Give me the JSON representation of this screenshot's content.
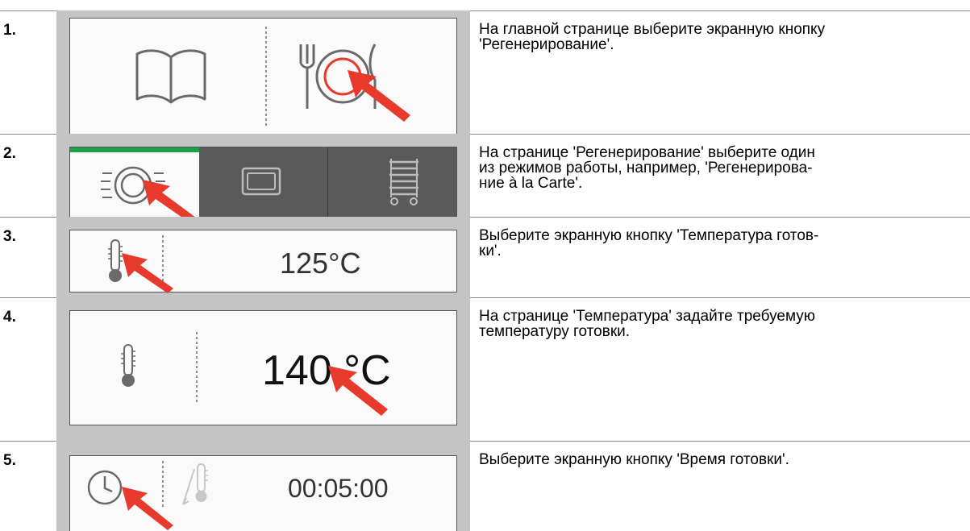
{
  "steps": [
    {
      "number": "1.",
      "lines": [
        "На главной странице выберите экранную кнопку",
        "'Регенерирование'."
      ]
    },
    {
      "number": "2.",
      "lines": [
        "На странице 'Регенерирование' выберите один",
        "из режимов работы, например, 'Регенерирова-",
        "ние à la Carte'."
      ]
    },
    {
      "number": "3.",
      "lines": [
        "Выберите экранную кнопку 'Температура готов-",
        "ки'."
      ],
      "screen_value": "125°C"
    },
    {
      "number": "4.",
      "lines": [
        "На странице 'Температура' задайте требуемую",
        "температуру готовки."
      ],
      "screen_value": "140 °C"
    },
    {
      "number": "5.",
      "lines": [
        "Выберите экранную кнопку 'Время готовки'."
      ],
      "screen_value": "00:05:00"
    }
  ],
  "colors": {
    "arrow": "#e8392d",
    "accent_green": "#1f9e4a",
    "frame_gray": "#c4c4c4",
    "dark_panel": "#5a5a5a",
    "icon_gray": "#6a6a6a"
  },
  "icons": [
    "open-book",
    "plate-with-cutlery",
    "plate-regenerate",
    "tray-gastronorm",
    "plate-rack",
    "thermometer",
    "clock",
    "core-probe"
  ]
}
